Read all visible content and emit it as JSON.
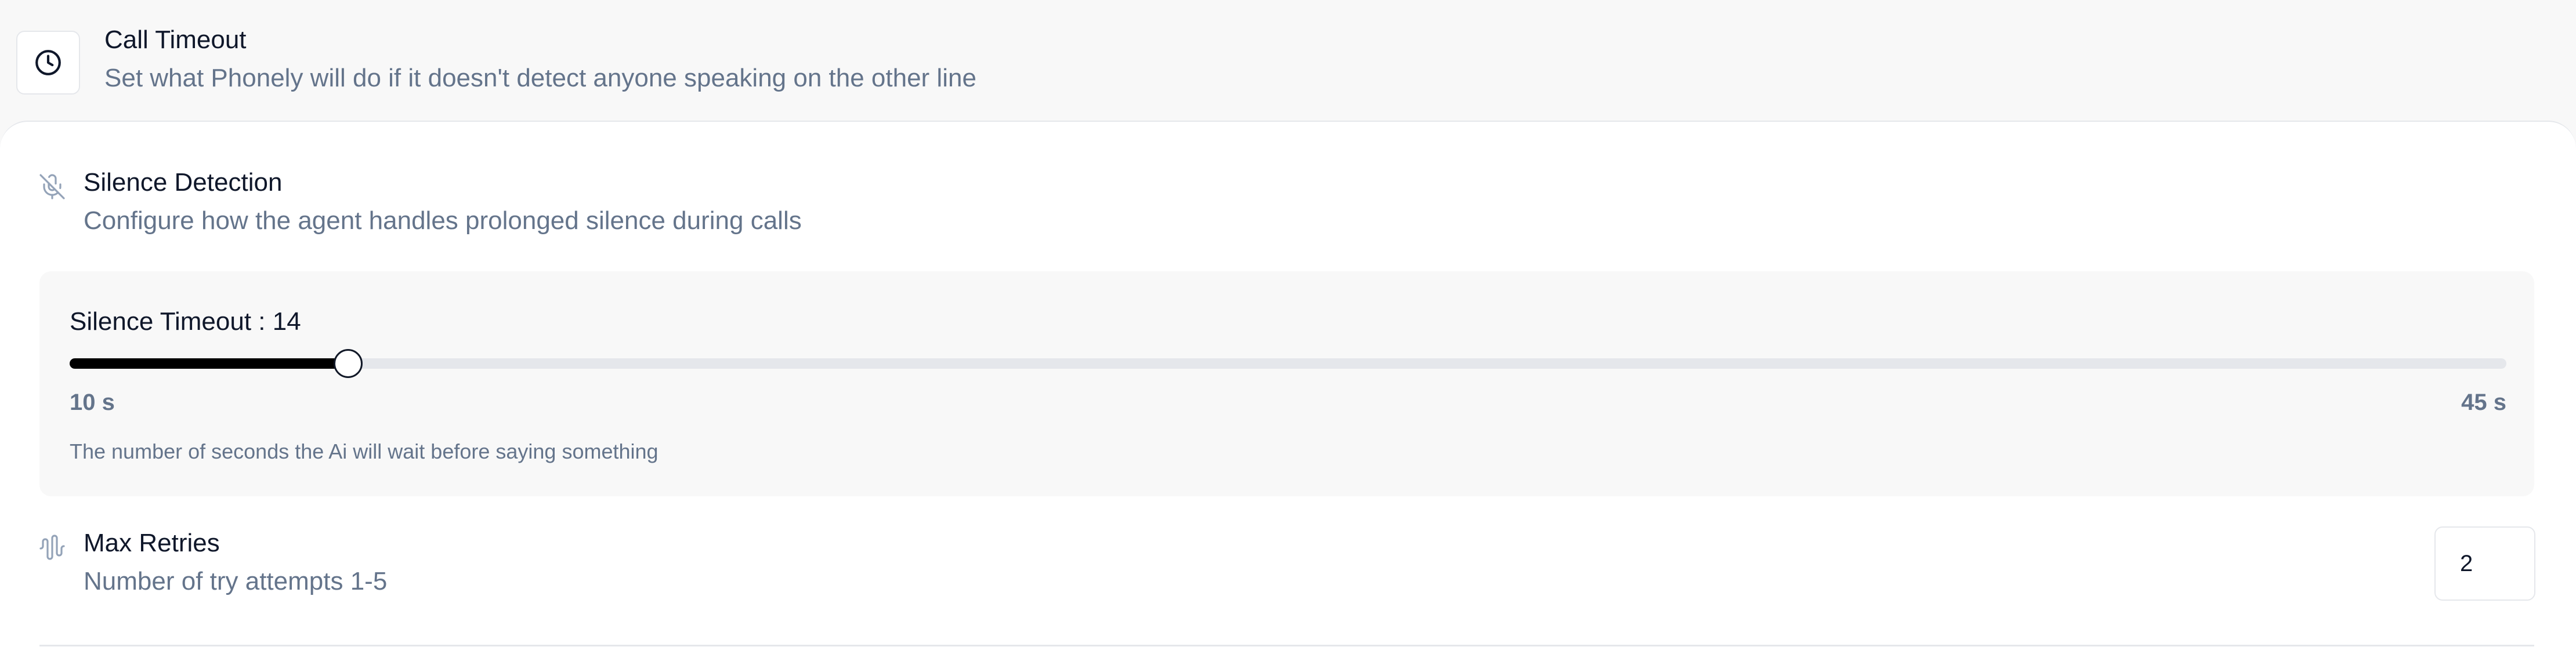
{
  "header": {
    "icon": "clock-icon",
    "title": "Call Timeout",
    "description": "Set what Phonely will do if it doesn't detect anyone speaking on the other line"
  },
  "silence_detection": {
    "icon": "mic-off-icon",
    "title": "Silence Detection",
    "description": "Configure how the agent handles prolonged silence during calls",
    "slider": {
      "label": "Silence Timeout : 14",
      "value": 14,
      "min": 10,
      "max": 45,
      "min_label": "10 s",
      "max_label": "45 s",
      "help_text": "The number of seconds the Ai will wait before saying something"
    }
  },
  "max_retries": {
    "icon": "waveform-icon",
    "title": "Max Retries",
    "description": "Number of try attempts 1-5",
    "value": "2"
  }
}
